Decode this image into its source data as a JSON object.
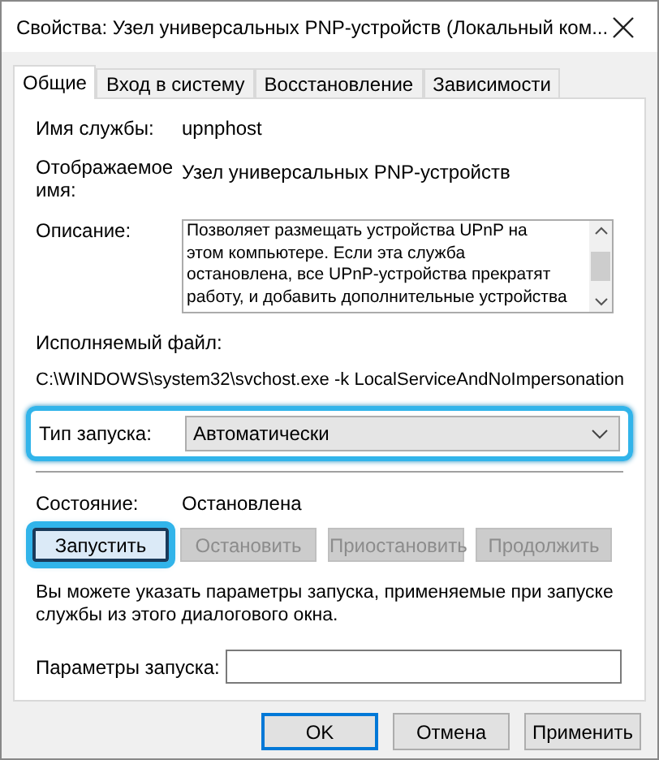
{
  "window": {
    "title": "Свойства: Узел универсальных PNP-устройств (Локальный ком..."
  },
  "tabs": [
    {
      "label": "Общие",
      "selected": true
    },
    {
      "label": "Вход в систему",
      "selected": false
    },
    {
      "label": "Восстановление",
      "selected": false
    },
    {
      "label": "Зависимости",
      "selected": false
    }
  ],
  "service_name": {
    "label": "Имя службы:",
    "value": "upnphost"
  },
  "display_name": {
    "label": "Отображаемое имя:",
    "value": "Узел универсальных PNP-устройств"
  },
  "description": {
    "label": "Описание:",
    "lines": [
      "Позволяет размещать устройства UPnP на",
      "этом компьютере. Если эта служба",
      "остановлена, все UPnP-устройства прекратят",
      "работу, и добавить дополнительные устройства"
    ]
  },
  "executable": {
    "label": "Исполняемый файл:",
    "value": "C:\\WINDOWS\\system32\\svchost.exe -k LocalServiceAndNoImpersonation"
  },
  "startup_type": {
    "label": "Тип запуска:",
    "value": "Автоматически",
    "highlighted": true
  },
  "status": {
    "label": "Состояние:",
    "value": "Остановлена"
  },
  "service_buttons": [
    {
      "label": "Запустить",
      "disabled": false,
      "highlighted": true
    },
    {
      "label": "Остановить",
      "disabled": true,
      "highlighted": false
    },
    {
      "label": "Приостановить",
      "disabled": true,
      "highlighted": false
    },
    {
      "label": "Продолжить",
      "disabled": true,
      "highlighted": false
    }
  ],
  "hint": "Вы можете указать параметры запуска, применяемые при запуске службы из этого диалогового окна.",
  "start_parameters": {
    "label": "Параметры запуска:"
  },
  "buttons": [
    {
      "label": "OK",
      "default": true
    },
    {
      "label": "Отмена",
      "default": false
    },
    {
      "label": "Применить",
      "default": false
    }
  ]
}
